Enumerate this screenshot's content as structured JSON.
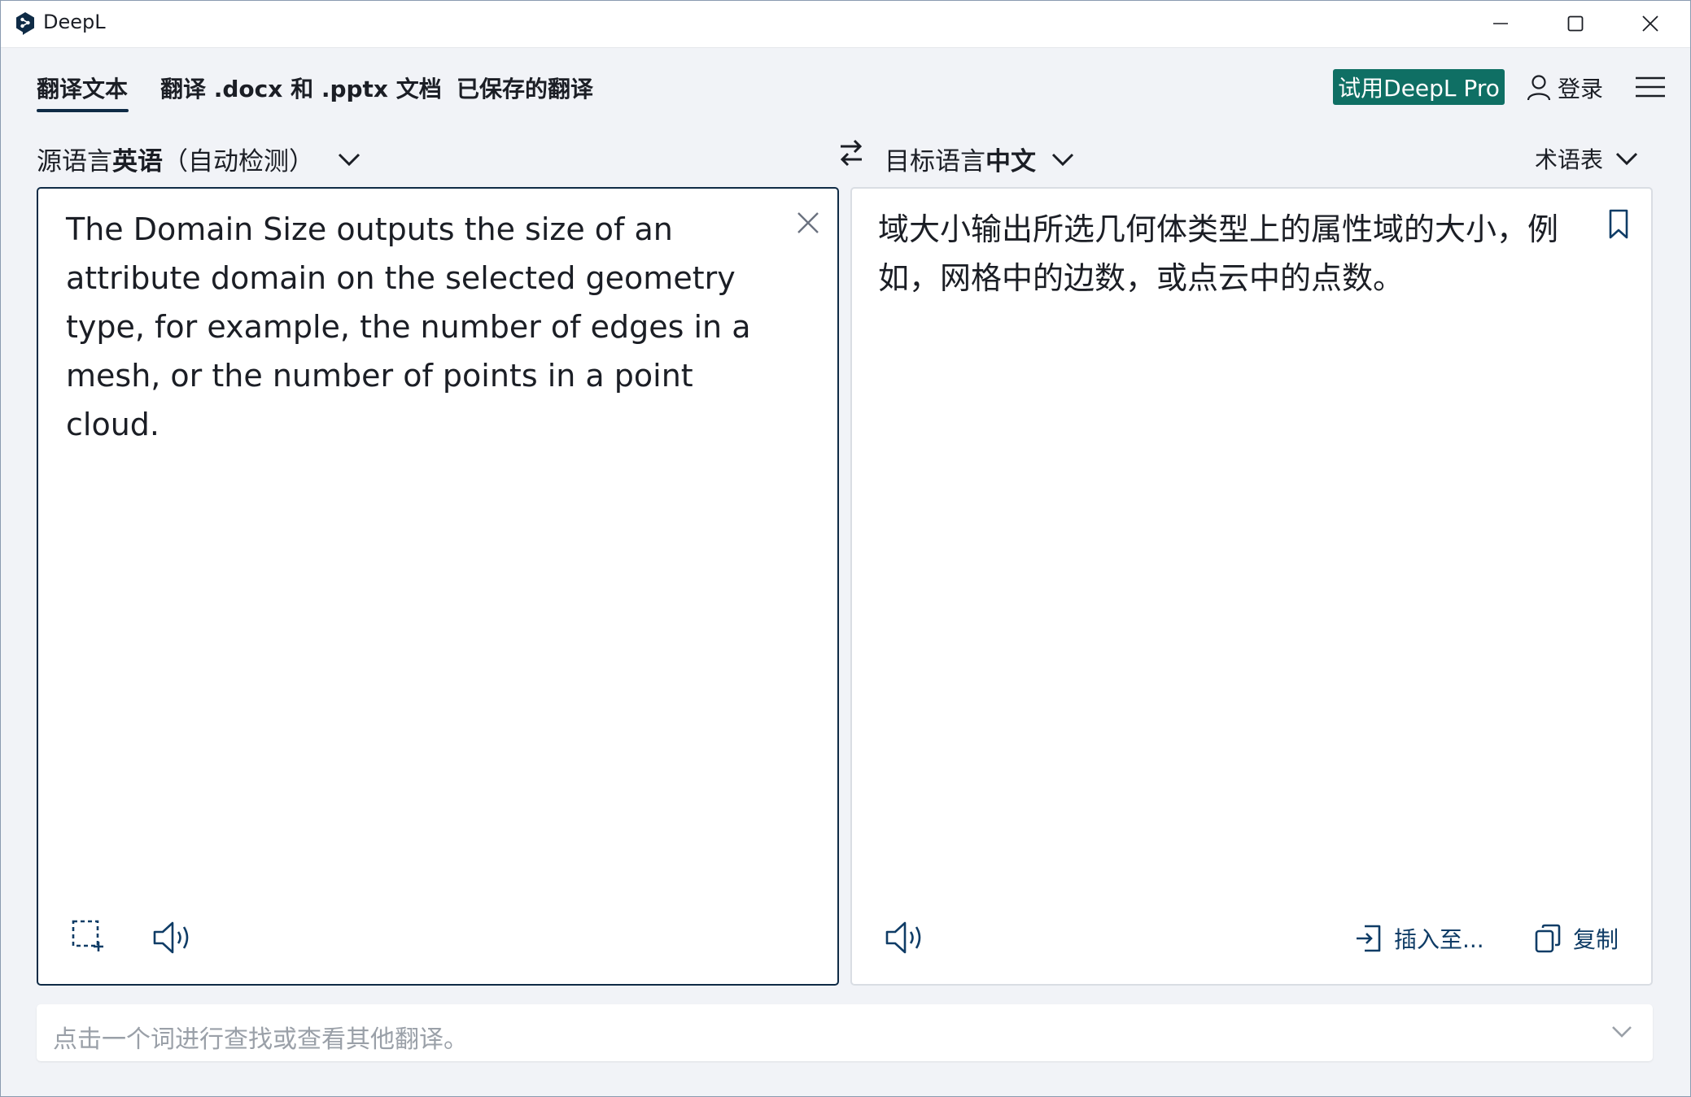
{
  "window": {
    "title": "DeepL"
  },
  "nav": {
    "tabs": [
      {
        "label": "翻译文本",
        "active": true
      },
      {
        "label": "翻译 .docx 和 .pptx 文档"
      },
      {
        "label": "已保存的翻译"
      }
    ],
    "pro_button": "试用DeepL Pro",
    "login": "登录"
  },
  "source": {
    "prefix": "源语言",
    "language": "英语",
    "detect": "（自动检测）",
    "text": "The Domain Size outputs the size of an attribute domain on the selected geometry type, for example, the number of edges in a mesh, or the number of points in a point cloud."
  },
  "target": {
    "prefix": "目标语言",
    "language": "中文",
    "glossary": "术语表",
    "text": "域大小输出所选几何体类型上的属性域的大小，例如，网格中的边数，或点云中的点数。",
    "insert_label": "插入至...",
    "copy_label": "复制"
  },
  "dictionary": {
    "hint": "点击一个词进行查找或查看其他翻译。"
  },
  "colors": {
    "accent": "#0f2b46",
    "pro_green": "#0f6f64",
    "background": "#f1f3f7",
    "link": "#0f3c66"
  },
  "icons": [
    "deepl-logo-icon",
    "minimize-icon",
    "maximize-icon",
    "close-icon",
    "user-icon",
    "hamburger-menu-icon",
    "chevron-down-icon",
    "swap-icon",
    "clear-icon",
    "bookmark-icon",
    "screenshot-select-icon",
    "speaker-icon",
    "insert-icon",
    "copy-icon"
  ]
}
